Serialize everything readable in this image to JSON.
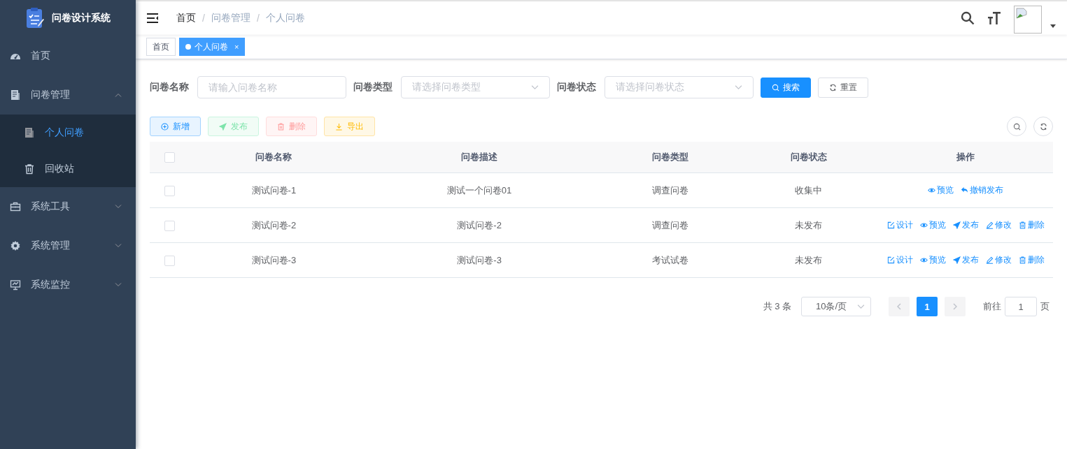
{
  "app": {
    "title": "问卷设计系统"
  },
  "sidebar": {
    "items": [
      {
        "label": "首页",
        "kind": "dashboard",
        "selected": false
      },
      {
        "label": "问卷管理",
        "kind": "doc",
        "selected": false,
        "expanded": true,
        "children": [
          {
            "label": "个人问卷",
            "kind": "doc",
            "selected": true
          },
          {
            "label": "回收站",
            "kind": "trash",
            "selected": false
          }
        ]
      },
      {
        "label": "系统工具",
        "kind": "toolbox",
        "selected": false,
        "expanded": false
      },
      {
        "label": "系统管理",
        "kind": "gear",
        "selected": false,
        "expanded": false
      },
      {
        "label": "系统监控",
        "kind": "monitor",
        "selected": false,
        "expanded": false
      }
    ]
  },
  "breadcrumb": [
    {
      "label": "首页"
    },
    {
      "separator": "/",
      "label": "问卷管理"
    },
    {
      "separator": "/",
      "label": "个人问卷"
    }
  ],
  "tabs": [
    {
      "label": "首页",
      "selected": false
    },
    {
      "label": "个人问卷",
      "selected": true,
      "close": "×"
    }
  ],
  "filters": [
    {
      "label": "问卷名称",
      "kind": "input",
      "placeholder": "请输入问卷名称"
    },
    {
      "label": "问卷类型",
      "kind": "select",
      "placeholder": "请选择问卷类型"
    },
    {
      "label": "问卷状态",
      "kind": "select",
      "placeholder": "请选择问卷状态"
    }
  ],
  "filter_buttons": [
    {
      "label": "搜索",
      "kind": "search"
    },
    {
      "label": "重置",
      "kind": "reset"
    }
  ],
  "toolbar": [
    {
      "label": "新增",
      "kind": "add",
      "disabled": false
    },
    {
      "label": "发布",
      "kind": "publish",
      "disabled": true
    },
    {
      "label": "删除",
      "kind": "delete",
      "disabled": true
    },
    {
      "label": "导出",
      "kind": "export",
      "disabled": false
    }
  ],
  "table": {
    "select_all_checked": false,
    "columns": [
      "问卷名称",
      "问卷描述",
      "问卷类型",
      "问卷状态",
      "操作"
    ],
    "rows": [
      {
        "checked": false,
        "cells": [
          "测试问卷-1",
          "测试一个问卷01",
          "调查问卷",
          "收集中"
        ],
        "actions": [
          {
            "label": "预览",
            "kind": "preview"
          },
          {
            "label": "撤销发布",
            "kind": "revoke"
          }
        ]
      },
      {
        "checked": false,
        "cells": [
          "测试问卷-2",
          "测试问卷-2",
          "调查问卷",
          "未发布"
        ],
        "actions": [
          {
            "label": "设计",
            "kind": "design"
          },
          {
            "label": "预览",
            "kind": "preview"
          },
          {
            "label": "发布",
            "kind": "publish"
          },
          {
            "label": "修改",
            "kind": "edit"
          },
          {
            "label": "删除",
            "kind": "delete"
          }
        ]
      },
      {
        "checked": false,
        "cells": [
          "测试问卷-3",
          "测试问卷-3",
          "考试试卷",
          "未发布"
        ],
        "actions": [
          {
            "label": "设计",
            "kind": "design"
          },
          {
            "label": "预览",
            "kind": "preview"
          },
          {
            "label": "发布",
            "kind": "publish"
          },
          {
            "label": "修改",
            "kind": "edit"
          },
          {
            "label": "删除",
            "kind": "delete"
          }
        ]
      }
    ]
  },
  "pagination": {
    "total": "共 3 条",
    "page_size": "10条/页",
    "pages": [
      {
        "label": "1",
        "selected": true
      }
    ],
    "goto_label": "前往",
    "goto_value": "1",
    "goto_suffix": "页"
  }
}
